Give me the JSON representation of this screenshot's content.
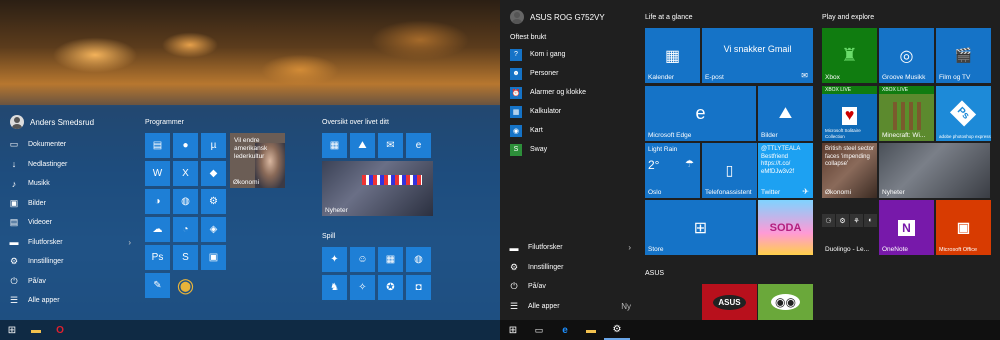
{
  "left": {
    "user": "Anders Smedsrud",
    "nav": [
      {
        "label": "Dokumenter",
        "icon": "document-icon"
      },
      {
        "label": "Nedlastinger",
        "icon": "download-icon"
      },
      {
        "label": "Musikk",
        "icon": "music-icon"
      },
      {
        "label": "Bilder",
        "icon": "pictures-icon"
      },
      {
        "label": "Videoer",
        "icon": "video-icon"
      },
      {
        "label": "Filutforsker",
        "icon": "folder-icon"
      },
      {
        "label": "Innstillinger",
        "icon": "gear-icon"
      },
      {
        "label": "På/av",
        "icon": "power-icon"
      },
      {
        "label": "Alle apper",
        "icon": "all-apps-icon"
      }
    ],
    "groups": {
      "programmer": "Programmer",
      "oversikt": "Oversikt over livet ditt",
      "spill": "Spill"
    },
    "news_tile": {
      "headline": "Vil endre amerikansk lederkultur",
      "source": "Økonomi"
    },
    "nyheter_label": "Nyheter"
  },
  "right": {
    "device": "ASUS ROG G752VY",
    "most_used_title": "Oftest brukt",
    "most_used": [
      "Kom i gang",
      "Personer",
      "Alarmer og klokke",
      "Kalkulator",
      "Kart",
      "Sway"
    ],
    "bottom": {
      "explorer": "Filutforsker",
      "settings": "Innstillinger",
      "power": "På/av",
      "all_apps": "Alle apper",
      "new_badge": "Ny"
    },
    "groups": {
      "glance": "Life at a glance",
      "play": "Play and explore",
      "asus": "ASUS"
    },
    "tiles": {
      "calendar": "Kalender",
      "mail_big": "Vi snakker Gmail",
      "mail": "E-post",
      "edge": "Microsoft Edge",
      "photos": "Bilder",
      "weather_cond": "Light Rain",
      "weather_temp": "2°",
      "weather_city": "Oslo",
      "phone": "Telefonassistent",
      "twitter_text": "@TTLYTEALA Bestfriend 👉 eMfDJw3v2f",
      "twitter_handle": "@TTLYTEALA Bestfriend",
      "twitter_link": "https://t.co/",
      "twitter_code": "eMfDJw3v2f",
      "twitter": "Twitter",
      "store": "Store",
      "candy": "SODA",
      "xbox": "Xbox",
      "groove": "Groove Musikk",
      "film": "Film og TV",
      "solitaire": "Microsoft Solitaire Collection",
      "minecraft": "Minecraft: Wi...",
      "xbox_live": "XBOX LIVE",
      "photoshop": "adobe photoshop express",
      "news_headline": "British steel sector faces 'impending collapse'",
      "news_source": "Økonomi",
      "nyheter": "Nyheter",
      "duolingo": "Duolingo - Le...",
      "onenote": "OneNote",
      "office": "Microsoft Office",
      "asus_tile": "ASUS"
    }
  },
  "colors": {
    "tile_blue": "#1573c7",
    "tile_dark": "#0063b1",
    "left_tile": "#1e7fd6",
    "green": "#2d8f3a"
  }
}
